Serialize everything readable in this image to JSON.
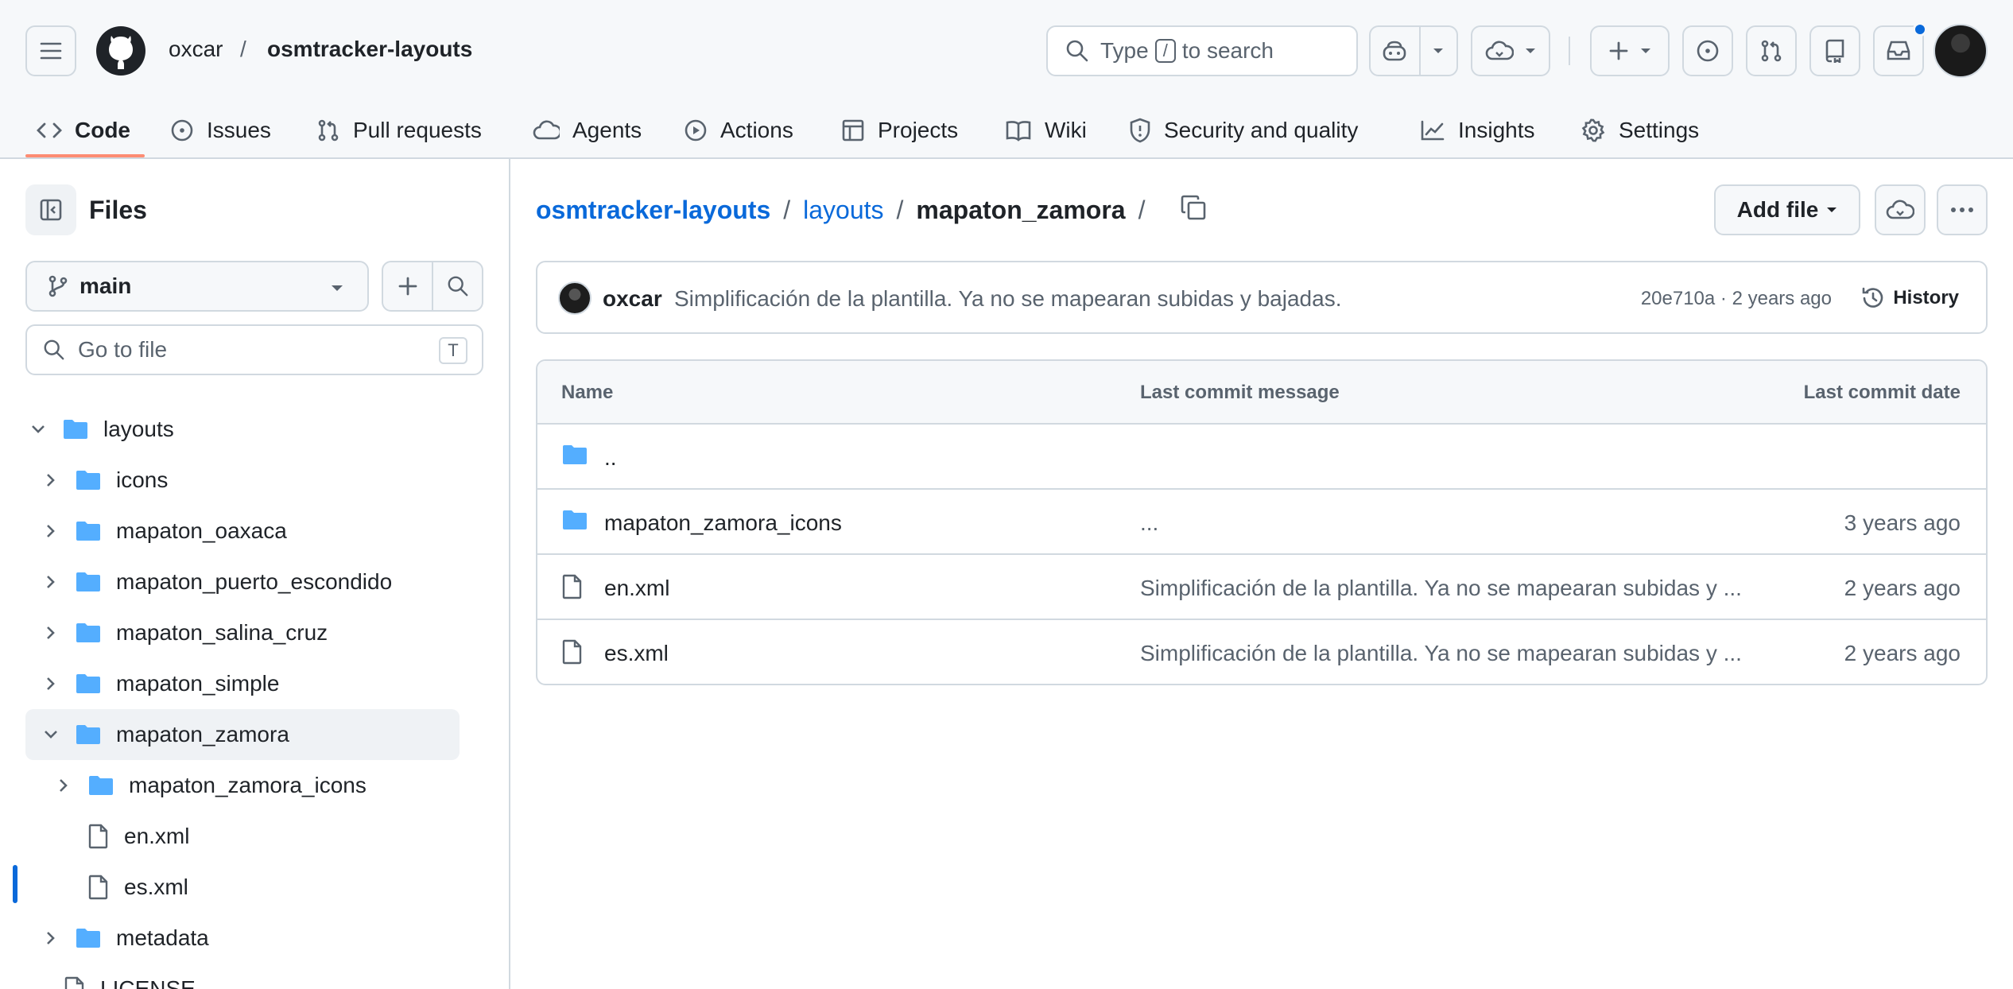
{
  "header": {
    "owner": "oxcar",
    "separator": "/",
    "repo": "osmtracker-layouts",
    "search": {
      "prefix": "Type",
      "key": "/",
      "suffix": "to search"
    }
  },
  "tabs": [
    {
      "label": "Code",
      "icon": "code-icon",
      "selected": true
    },
    {
      "label": "Issues",
      "icon": "issue-icon"
    },
    {
      "label": "Pull requests",
      "icon": "pull-request-icon"
    },
    {
      "label": "Agents",
      "icon": "agents-icon"
    },
    {
      "label": "Actions",
      "icon": "play-icon"
    },
    {
      "label": "Projects",
      "icon": "table-icon"
    },
    {
      "label": "Wiki",
      "icon": "book-icon"
    },
    {
      "label": "Security and quality",
      "icon": "shield-icon"
    },
    {
      "label": "Insights",
      "icon": "graph-icon"
    },
    {
      "label": "Settings",
      "icon": "gear-icon"
    }
  ],
  "sidebar": {
    "title": "Files",
    "branch": "main",
    "goto_placeholder": "Go to file",
    "goto_key": "T",
    "tree": [
      {
        "label": "layouts",
        "type": "folder",
        "expanded": true
      },
      {
        "label": "icons",
        "type": "folder"
      },
      {
        "label": "mapaton_oaxaca",
        "type": "folder"
      },
      {
        "label": "mapaton_puerto_escondido",
        "type": "folder"
      },
      {
        "label": "mapaton_salina_cruz",
        "type": "folder"
      },
      {
        "label": "mapaton_simple",
        "type": "folder"
      },
      {
        "label": "mapaton_zamora",
        "type": "folder",
        "expanded": true,
        "selected": true
      },
      {
        "label": "mapaton_zamora_icons",
        "type": "folder"
      },
      {
        "label": "en.xml",
        "type": "file"
      },
      {
        "label": "es.xml",
        "type": "file"
      },
      {
        "label": "metadata",
        "type": "folder"
      },
      {
        "label": "LICENSE",
        "type": "file"
      }
    ]
  },
  "main": {
    "path": {
      "repo": "osmtracker-layouts",
      "dir": "layouts",
      "current": "mapaton_zamora",
      "trailing": "/"
    },
    "add_file": "Add file",
    "commit": {
      "author": "oxcar",
      "message": "Simplificación de la plantilla. Ya no se mapearan subidas y bajadas.",
      "meta": "20e710a · 2 years ago",
      "history": "History"
    },
    "table": {
      "headers": {
        "name": "Name",
        "message": "Last commit message",
        "date": "Last commit date"
      },
      "rows": [
        {
          "name": "..",
          "type": "folder",
          "message": "",
          "date": ""
        },
        {
          "name": "mapaton_zamora_icons",
          "type": "folder",
          "message": "...",
          "date": "3 years ago"
        },
        {
          "name": "en.xml",
          "type": "file",
          "message": "Simplificación de la plantilla. Ya no se mapearan subidas y ...",
          "date": "2 years ago"
        },
        {
          "name": "es.xml",
          "type": "file",
          "message": "Simplificación de la plantilla. Ya no se mapearan subidas y ...",
          "date": "2 years ago"
        }
      ]
    }
  },
  "colors": {
    "accent": "#0969da",
    "folder": "#54aeff",
    "tab_underline": "#fd8c73",
    "border": "#d1d9e0"
  }
}
